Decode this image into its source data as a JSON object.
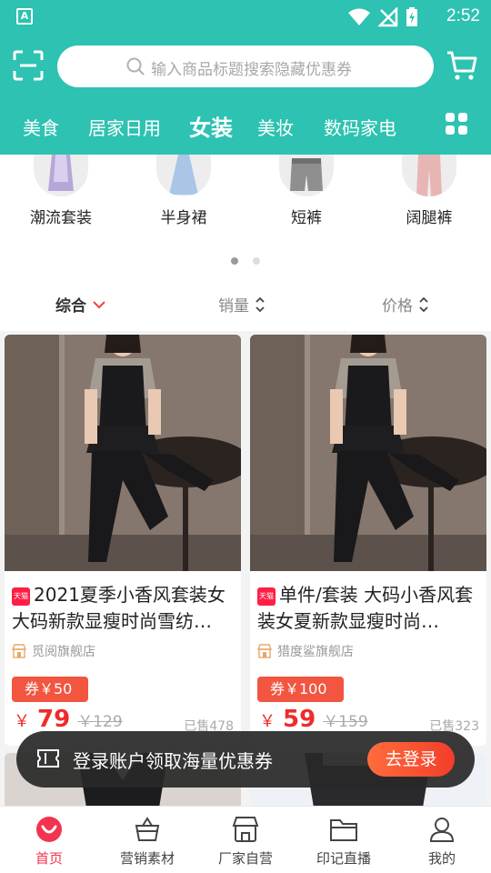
{
  "status": {
    "a_label": "A",
    "time": "2:52"
  },
  "search": {
    "placeholder": "输入商品标题搜索隐藏优惠券"
  },
  "categories": [
    {
      "label": "美食"
    },
    {
      "label": "居家日用"
    },
    {
      "label": "女装"
    },
    {
      "label": "美妆"
    },
    {
      "label": "数码家电"
    }
  ],
  "subcategories": [
    {
      "label": "潮流套装"
    },
    {
      "label": "半身裙"
    },
    {
      "label": "短裤"
    },
    {
      "label": "阔腿裤"
    }
  ],
  "sort": {
    "composite": "综合",
    "sales": "销量",
    "price": "价格"
  },
  "products": [
    {
      "badge": "天猫",
      "title": "2021夏季小香风套装女大码新款显瘦时尚雪纺…",
      "shop": "觅阅旗舰店",
      "coupon": "券￥50",
      "currency": "￥",
      "price": "79",
      "old_price": "￥129",
      "sold": "已售478"
    },
    {
      "badge": "天猫",
      "title": "单件/套装 大码小香风套装女夏新款显瘦时尚…",
      "shop": "猎度鲨旗舰店",
      "coupon": "券￥100",
      "currency": "￥",
      "price": "59",
      "old_price": "￥159",
      "sold": "已售323"
    }
  ],
  "login_prompt": {
    "message": "登录账户领取海量优惠券",
    "button": "去登录"
  },
  "tabbar": [
    {
      "label": "首页"
    },
    {
      "label": "营销素材"
    },
    {
      "label": "厂家自营"
    },
    {
      "label": "印记直播"
    },
    {
      "label": "我的"
    }
  ],
  "colors": {
    "brand": "#2dc2b1",
    "accent_red": "#f02b2b",
    "tab_active": "#f4334e"
  }
}
